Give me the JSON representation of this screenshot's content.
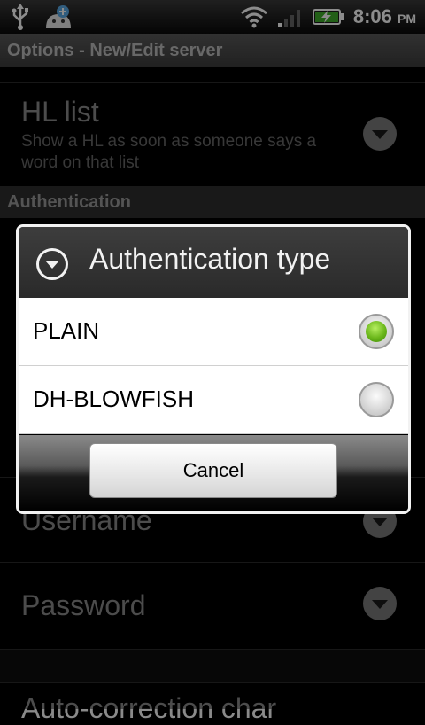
{
  "status_bar": {
    "time": "8:06",
    "ampm": "PM",
    "icons": [
      "usb-icon",
      "android-notification-icon",
      "wifi-icon",
      "signal-icon",
      "battery-charging-icon"
    ]
  },
  "background": {
    "title": "Options - New/Edit server",
    "hl_list": {
      "title": "HL list",
      "summary": "Show a HL as soon as someone says a word on that list"
    },
    "section_authentication": "Authentication",
    "username": "Username",
    "password": "Password",
    "auto_correction": "Auto-correction char"
  },
  "dialog": {
    "title": "Authentication type",
    "options": [
      {
        "label": "PLAIN",
        "selected": true
      },
      {
        "label": "DH-BLOWFISH",
        "selected": false
      }
    ],
    "cancel_label": "Cancel",
    "accent_color": "#6ab61a"
  }
}
